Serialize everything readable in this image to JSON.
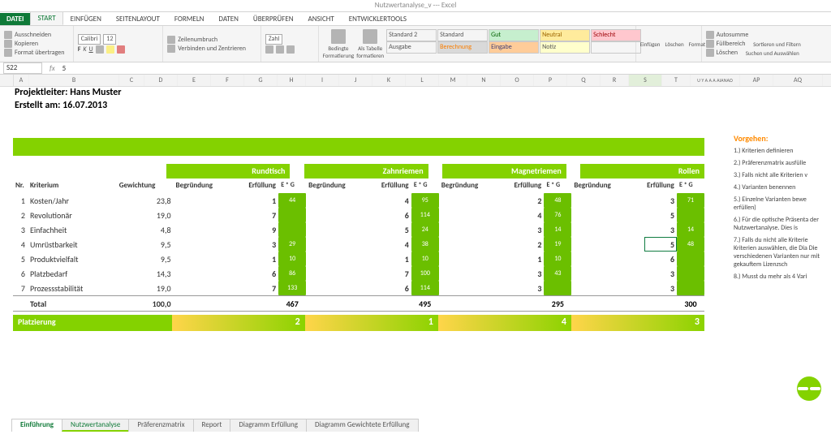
{
  "titlebar": "Nutzwertanalyse_v --- Excel",
  "ribbon": {
    "file": "DATEI",
    "tabs": [
      "START",
      "EINFÜGEN",
      "SEITENLAYOUT",
      "FORMELN",
      "DATEN",
      "ÜBERPRÜFEN",
      "ANSICHT",
      "ENTWICKLERTOOLS"
    ],
    "active_tab": "START",
    "clipboard": {
      "cut": "Ausschneiden",
      "copy": "Kopieren",
      "paint": "Format übertragen"
    },
    "font": {
      "name": "Calibri",
      "size": "12",
      "bold": "F",
      "italic": "K",
      "underline": "U"
    },
    "align": {
      "wrap": "Zeilenumbruch",
      "merge": "Verbinden und Zentrieren"
    },
    "number": {
      "label": "Zahl"
    },
    "styles": {
      "cond": "Bedingte Formatierung",
      "table": "Als Tabelle formatieren",
      "cells": [
        [
          "Standard 2",
          "Standard",
          "Gut",
          "Neutral",
          "Schlecht"
        ],
        [
          "Ausgabe",
          "Berechnung",
          "Eingabe",
          "Notiz",
          ""
        ]
      ]
    },
    "cells": {
      "insert": "Einfügen",
      "delete": "Löschen",
      "format": "Format"
    },
    "editing": {
      "sum": "Autosumme",
      "fill": "Füllbereich",
      "clear": "Löschen",
      "sort": "Sortieren und Filtern",
      "find": "Suchen und Auswählen"
    }
  },
  "namebox": "S22",
  "fx_value": "5",
  "columns": [
    "A",
    "B",
    "C",
    "D",
    "E",
    "F",
    "G",
    "H",
    "I",
    "J",
    "K",
    "L",
    "M",
    "N",
    "O",
    "P",
    "Q",
    "R",
    "S",
    "T",
    "U Y A A A AIANAO",
    "AP",
    "AQ"
  ],
  "header": {
    "line1": "Projektleiter: Hans Muster",
    "line2": "Erstellt am: 16.07.2013"
  },
  "variants": [
    "Rundtisch",
    "Zahnriemen",
    "Magnetriemen",
    "Rollen"
  ],
  "sub": {
    "nr": "Nr.",
    "krit": "Kriterium",
    "gew": "Gewichtung",
    "beg": "Begründung",
    "erf": "Erfüllung",
    "eg": "E * G"
  },
  "rows": [
    {
      "nr": "1",
      "krit": "Kosten/Jahr",
      "gew": "23,8",
      "v": [
        {
          "e": "1",
          "eg": "44"
        },
        {
          "e": "4",
          "eg": "95"
        },
        {
          "e": "2",
          "eg": "48"
        },
        {
          "e": "3",
          "eg": "71"
        }
      ]
    },
    {
      "nr": "2",
      "krit": "Revolutionär",
      "gew": "19,0",
      "v": [
        {
          "e": "7",
          "eg": ""
        },
        {
          "e": "6",
          "eg": "114"
        },
        {
          "e": "4",
          "eg": "76"
        },
        {
          "e": "5",
          "eg": ""
        }
      ]
    },
    {
      "nr": "3",
      "krit": "Einfachheit",
      "gew": "4,8",
      "v": [
        {
          "e": "9",
          "eg": ""
        },
        {
          "e": "5",
          "eg": "24"
        },
        {
          "e": "3",
          "eg": "14"
        },
        {
          "e": "3",
          "eg": "14"
        }
      ]
    },
    {
      "nr": "4",
      "krit": "Umrüstbarkeit",
      "gew": "9,5",
      "v": [
        {
          "e": "3",
          "eg": "29"
        },
        {
          "e": "4",
          "eg": "38"
        },
        {
          "e": "2",
          "eg": "19"
        },
        {
          "e": "5",
          "eg": "48"
        }
      ]
    },
    {
      "nr": "5",
      "krit": "Produktvielfalt",
      "gew": "9,5",
      "v": [
        {
          "e": "1",
          "eg": "10"
        },
        {
          "e": "1",
          "eg": "10"
        },
        {
          "e": "1",
          "eg": "10"
        },
        {
          "e": "6",
          "eg": ""
        }
      ]
    },
    {
      "nr": "6",
      "krit": "Platzbedarf",
      "gew": "14,3",
      "v": [
        {
          "e": "6",
          "eg": "86"
        },
        {
          "e": "7",
          "eg": "100"
        },
        {
          "e": "3",
          "eg": "43"
        },
        {
          "e": "3",
          "eg": ""
        }
      ]
    },
    {
      "nr": "7",
      "krit": "Prozessstabilität",
      "gew": "19,0",
      "v": [
        {
          "e": "7",
          "eg": "133"
        },
        {
          "e": "6",
          "eg": "114"
        },
        {
          "e": "3",
          "eg": ""
        },
        {
          "e": "3",
          "eg": ""
        }
      ]
    }
  ],
  "total": {
    "label": "Total",
    "gew": "100,0",
    "v": [
      "467",
      "495",
      "295",
      "300"
    ]
  },
  "place": {
    "label": "Platzierung",
    "v": [
      "2",
      "1",
      "4",
      "3"
    ]
  },
  "vorgehen": {
    "title": "Vorgehen:",
    "items": [
      "1.) Kriterien definieren",
      "2.) Präferenzmatrix ausfülle",
      "3.) Falls nicht alle Kriterien v",
      "4.) Varianten benennen",
      "5.) Einzelne Varianten bewe erfüllen)",
      "6.) Für die optische Präsenta der Nutzwertanalyse. Dies is",
      "7.) Falls du nicht alle Kriterie Kriterien auswählen, die Dia Die verschiedenen Varianten nur mit gekauftem Lizenzsch",
      "8.) Musst du mehr als 4 Vari"
    ]
  },
  "sheets": [
    "Einführung",
    "Nutzwertanalyse",
    "Präferenzmatrix",
    "Report",
    "Diagramm Erfüllung",
    "Diagramm Gewichtete Erfüllung"
  ],
  "active_sheet": 0,
  "chart_data": {
    "type": "table",
    "title": "Nutzwertanalyse",
    "criteria": [
      "Kosten/Jahr",
      "Revolutionär",
      "Einfachheit",
      "Umrüstbarkeit",
      "Produktvielfalt",
      "Platzbedarf",
      "Prozessstabilität"
    ],
    "weights": [
      23.8,
      19.0,
      4.8,
      9.5,
      9.5,
      14.3,
      19.0
    ],
    "variants": [
      "Rundtisch",
      "Zahnriemen",
      "Magnetriemen",
      "Rollen"
    ],
    "fulfillment": [
      [
        1,
        4,
        2,
        3
      ],
      [
        7,
        6,
        4,
        5
      ],
      [
        9,
        5,
        3,
        3
      ],
      [
        3,
        4,
        2,
        5
      ],
      [
        1,
        1,
        1,
        6
      ],
      [
        6,
        7,
        3,
        3
      ],
      [
        7,
        6,
        3,
        3
      ]
    ],
    "totals": [
      467,
      495,
      295,
      300
    ],
    "rank": [
      2,
      1,
      4,
      3
    ]
  }
}
